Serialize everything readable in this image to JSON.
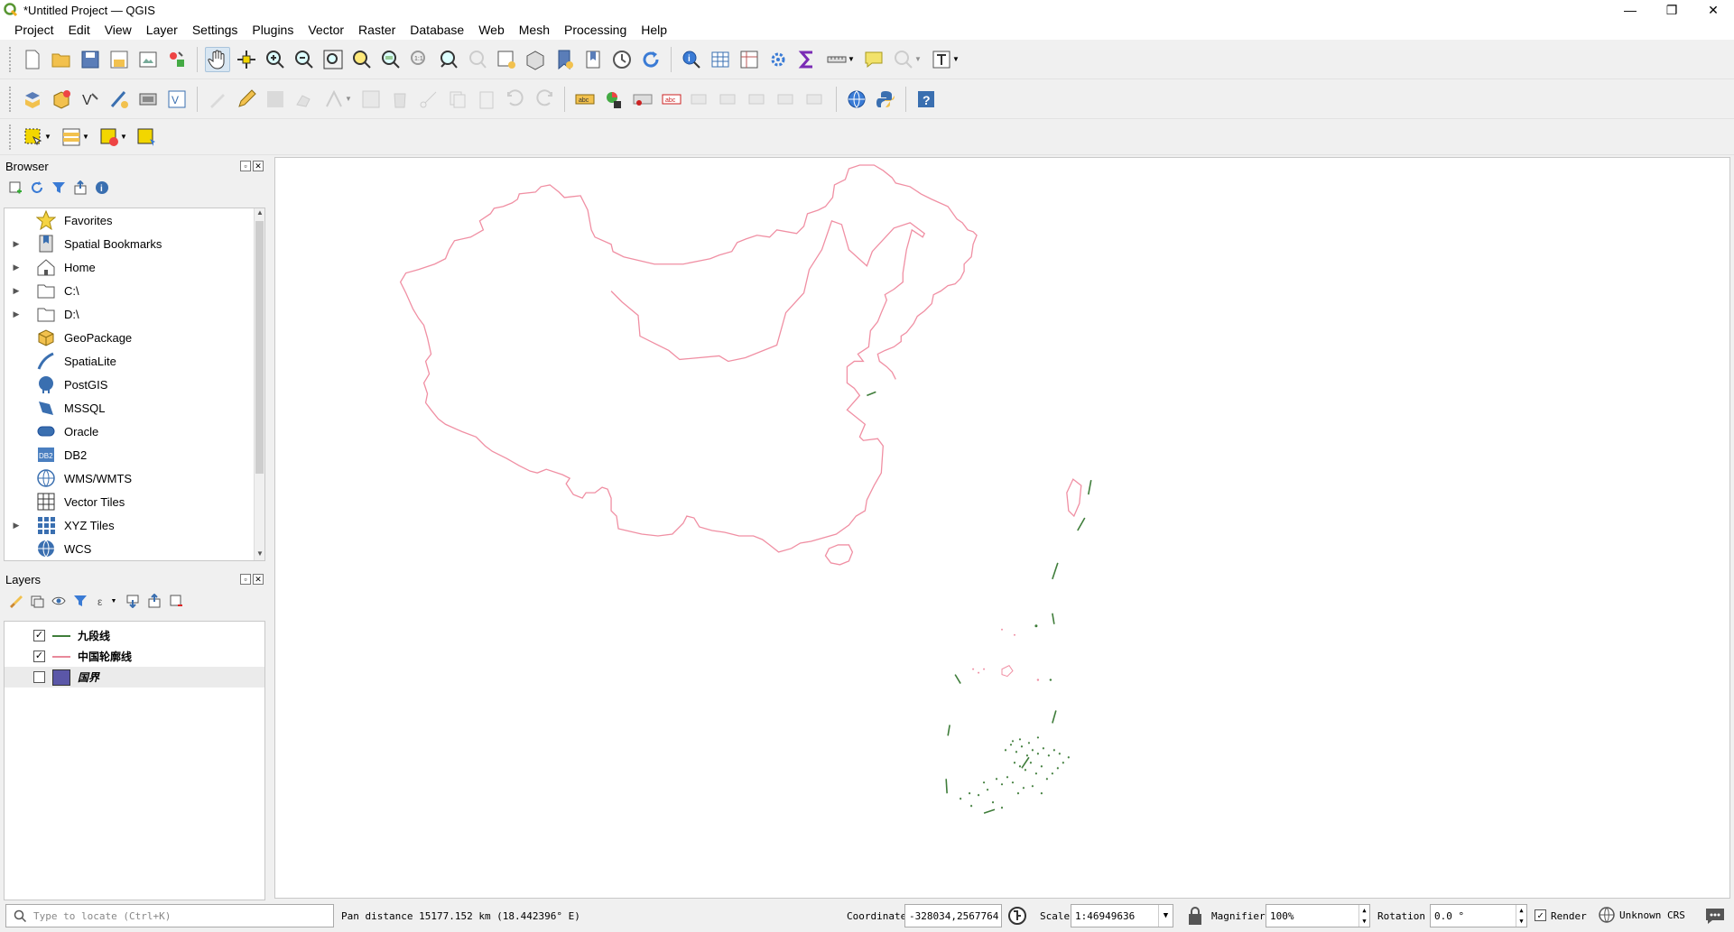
{
  "window": {
    "title": "*Untitled Project — QGIS",
    "minimize": "—",
    "maximize": "❐",
    "close": "✕"
  },
  "menubar": [
    "Project",
    "Edit",
    "View",
    "Layer",
    "Settings",
    "Plugins",
    "Vector",
    "Raster",
    "Database",
    "Web",
    "Mesh",
    "Processing",
    "Help"
  ],
  "browser": {
    "title": "Browser",
    "items": [
      {
        "label": "Favorites",
        "icon": "star-icon",
        "expandable": false
      },
      {
        "label": "Spatial Bookmarks",
        "icon": "bookmark-icon",
        "expandable": true
      },
      {
        "label": "Home",
        "icon": "home-icon",
        "expandable": true
      },
      {
        "label": "C:\\",
        "icon": "folder-icon",
        "expandable": true
      },
      {
        "label": "D:\\",
        "icon": "folder-icon",
        "expandable": true
      },
      {
        "label": "GeoPackage",
        "icon": "geopackage-icon",
        "expandable": false
      },
      {
        "label": "SpatiaLite",
        "icon": "spatialite-icon",
        "expandable": false
      },
      {
        "label": "PostGIS",
        "icon": "postgis-icon",
        "expandable": false
      },
      {
        "label": "MSSQL",
        "icon": "mssql-icon",
        "expandable": false
      },
      {
        "label": "Oracle",
        "icon": "oracle-icon",
        "expandable": false
      },
      {
        "label": "DB2",
        "icon": "db2-icon",
        "expandable": false
      },
      {
        "label": "WMS/WMTS",
        "icon": "wms-icon",
        "expandable": false
      },
      {
        "label": "Vector Tiles",
        "icon": "vector-tiles-icon",
        "expandable": false
      },
      {
        "label": "XYZ Tiles",
        "icon": "xyz-tiles-icon",
        "expandable": true
      },
      {
        "label": "WCS",
        "icon": "wcs-icon",
        "expandable": false
      }
    ]
  },
  "layers": {
    "title": "Layers",
    "items": [
      {
        "name": "九段线",
        "checked": true,
        "symbol": "line",
        "color": "#3f7d3a",
        "italic": false
      },
      {
        "name": "中国轮廓线",
        "checked": true,
        "symbol": "line",
        "color": "#e8899a",
        "italic": false
      },
      {
        "name": "国界",
        "checked": false,
        "symbol": "fill",
        "color": "#5b57a8",
        "italic": true
      }
    ]
  },
  "status": {
    "locator_placeholder": "Type to locate (Ctrl+K)",
    "message": "Pan distance 15177.152 km (18.442396° E)",
    "coordinate_label": "Coordinate",
    "coordinate_value": "-328034,2567764",
    "scale_label": "Scale",
    "scale_value": "1:46949636",
    "magnifier_label": "Magnifier",
    "magnifier_value": "100%",
    "rotation_label": "Rotation",
    "rotation_value": "0.0 °",
    "render_label": "Render",
    "render_checked": true,
    "crs_label": "Unknown CRS"
  },
  "colors": {
    "outline": "#f08fa3",
    "nine_dash": "#3f7d3a",
    "canvas_bg": "#ffffff"
  }
}
